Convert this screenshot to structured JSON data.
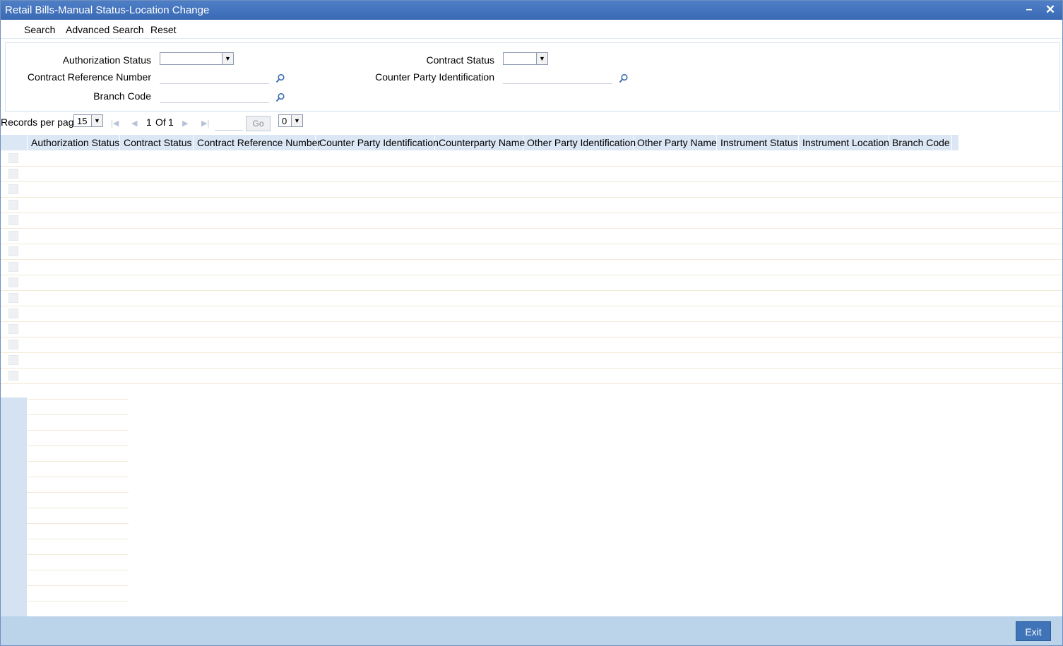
{
  "window": {
    "title": "Retail Bills-Manual Status-Location Change",
    "minimize_glyph": "–",
    "close_glyph": "✕"
  },
  "menu": {
    "search": "Search",
    "advanced_search": "Advanced Search",
    "reset": "Reset"
  },
  "criteria": {
    "authorization_status_label": "Authorization Status",
    "authorization_status_value": "",
    "contract_status_label": "Contract Status",
    "contract_status_value": "",
    "contract_reference_label": "Contract Reference Number",
    "contract_reference_value": "",
    "counter_party_id_label": "Counter Party Identification",
    "counter_party_id_value": "",
    "branch_code_label": "Branch Code",
    "branch_code_value": "",
    "lov_icon": "search-icon"
  },
  "pager": {
    "records_per_page_label": "Records per page",
    "records_per_page_value": "15",
    "current_page": "1",
    "of_label": "Of",
    "total_pages": "1",
    "go_label": "Go",
    "extra_select_value": "0"
  },
  "grid": {
    "columns": [
      "Authorization Status",
      "Contract Status",
      "Contract Reference Number",
      "Counter Party Identification",
      "Counterparty Name",
      "Other Party Identification",
      "Other Party Name",
      "Instrument Status",
      "Instrument Location",
      "Branch Code"
    ],
    "rows": []
  },
  "footer": {
    "exit_label": "Exit"
  },
  "colors": {
    "titlebar": "#3a69b4",
    "header": "#dce7f5",
    "footer": "#bcd4ea",
    "exit_button": "#3f74b8"
  }
}
